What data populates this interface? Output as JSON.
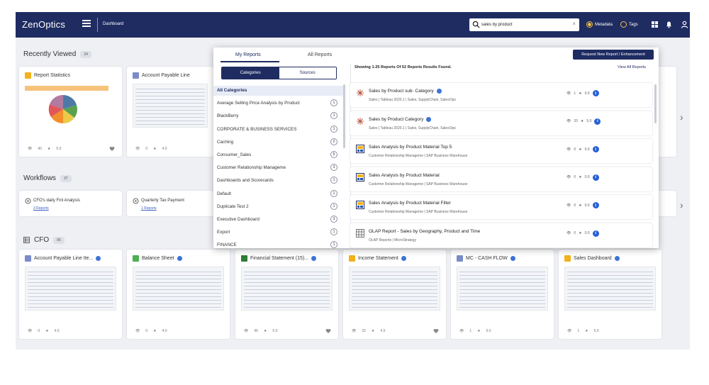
{
  "header": {
    "logo": "ZenOptics",
    "breadcrumb": "Dashboard",
    "search_value": "sales by product",
    "metadata_label": "Metadata",
    "tags_label": "Tags"
  },
  "recently_viewed": {
    "title": "Recently Viewed",
    "count": "24",
    "cards": [
      {
        "title": "Report Statistics",
        "views": "40",
        "rating": "5.0"
      },
      {
        "title": "Account Payable Line",
        "views": "0",
        "rating": "4.0"
      }
    ]
  },
  "workflows": {
    "title": "Workflows",
    "count": "37",
    "items": [
      {
        "title": "CFO's daily Finl Analysis",
        "sub": "3 Reports"
      },
      {
        "title": "Quarterly Tax Payment",
        "sub": "1 Reports"
      }
    ]
  },
  "cfo": {
    "title": "CFO",
    "count": "06",
    "cards": [
      {
        "title": "Account Payable Line Ite...",
        "views": "0",
        "rating": "4.0",
        "icon_color": "#7b8bc9"
      },
      {
        "title": "Balance Sheet",
        "views": "0",
        "rating": "4.0",
        "icon_color": "#4caf50"
      },
      {
        "title": "Financial Statement (15)...",
        "views": "46",
        "rating": "5.0",
        "icon_color": "#2e7d32"
      },
      {
        "title": "Income Statement",
        "views": "32",
        "rating": "4.5",
        "icon_color": "#f2b21b"
      },
      {
        "title": "MC - CASH FLOW",
        "views": "1",
        "rating": "5.0",
        "icon_color": "#7b8bc9"
      },
      {
        "title": "Sales Dashboard",
        "views": "1",
        "rating": "5.0",
        "icon_color": "#f2b21b"
      }
    ]
  },
  "popup": {
    "tabs": [
      "My Reports",
      "All Reports"
    ],
    "segments": [
      "Categories",
      "Sources"
    ],
    "request_button": "Request New Report / Enhancement",
    "showing_text": "Showing 1-25 Reports Of 52 Reports Results Found.",
    "view_all": "View All Reports",
    "categories": [
      {
        "label": "All Categories",
        "count": ""
      },
      {
        "label": "Average Selling Price Analysis by Product",
        "count": "1"
      },
      {
        "label": "BlackBerry",
        "count": "1"
      },
      {
        "label": "CORPORATE & BUSINESS SERVICES",
        "count": "1"
      },
      {
        "label": "Caching",
        "count": "2"
      },
      {
        "label": "Consumer_Sales",
        "count": "5"
      },
      {
        "label": "Customer Relationship Manageme",
        "count": "3"
      },
      {
        "label": "Dashboards and Scorecards",
        "count": "1"
      },
      {
        "label": "Default",
        "count": "1"
      },
      {
        "label": "Duplicate Test 2",
        "count": "1"
      },
      {
        "label": "Executive Dashboard",
        "count": "3"
      },
      {
        "label": "Export",
        "count": "1"
      },
      {
        "label": "FINANCE",
        "count": "1"
      }
    ],
    "results": [
      {
        "title": "Sales by Product sub- Category",
        "sub": "Sales | Tableau 2020.1 | Sales, SupplyChain, SalesOps",
        "views": "1",
        "rating": "0.0",
        "icon": "tableau",
        "verified": true
      },
      {
        "title": "Sales by Product Category",
        "sub": "Sales | Tableau 2020.1 | Sales, SupplyChain, SalesOps",
        "views": "33",
        "rating": "5.0",
        "icon": "tableau",
        "verified": true
      },
      {
        "title": "Sales Analysis by Product Material Top 5",
        "sub": "Customer Relationship Manageme | SAP Business Warehouse",
        "views": "0",
        "rating": "0.0",
        "icon": "sap",
        "verified": false
      },
      {
        "title": "Sales Analysis by Product Material",
        "sub": "Customer Relationship Manageme | SAP Business Warehouse",
        "views": "0",
        "rating": "0.0",
        "icon": "sap",
        "verified": false
      },
      {
        "title": "Sales Analysis by Product Material Filter",
        "sub": "Customer Relationship Manageme | SAP Business Warehouse",
        "views": "0",
        "rating": "0.0",
        "icon": "sap",
        "verified": false
      },
      {
        "title": "OLAP Report - Sales by Geography, Product and Time",
        "sub": "OLAP Reports | MicroStrategy",
        "views": "0",
        "rating": "0.0",
        "icon": "grid",
        "verified": false
      }
    ]
  }
}
